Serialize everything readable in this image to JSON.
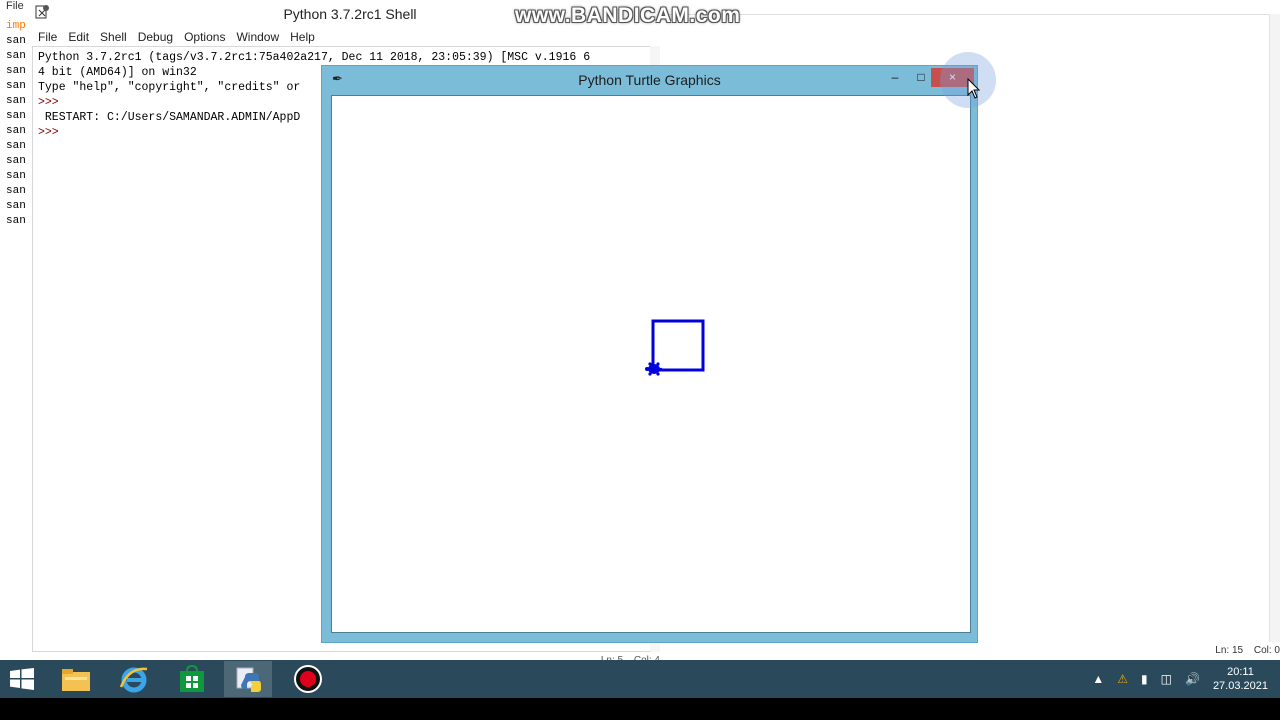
{
  "background_editor": {
    "menu_label": "File",
    "lines": [
      "imp",
      "san",
      "san",
      "san",
      "san",
      "san",
      "san",
      "san",
      "san",
      "san",
      "san",
      "san",
      "san",
      "san"
    ]
  },
  "right_editor": {
    "status_line": "Ln: 15",
    "status_col": "Col: 0"
  },
  "shell": {
    "title": "Python 3.7.2rc1 Shell",
    "menu": [
      "File",
      "Edit",
      "Shell",
      "Debug",
      "Options",
      "Window",
      "Help"
    ],
    "lines": [
      "Python 3.7.2rc1 (tags/v3.7.2rc1:75a402a217, Dec 11 2018, 23:05:39) [MSC v.1916 6",
      "4 bit (AMD64)] on win32",
      "Type \"help\", \"copyright\", \"credits\" or",
      ">>>",
      " RESTART: C:/Users/SAMANDAR.ADMIN/AppD",
      ">>>"
    ],
    "status_line": "Ln: 5",
    "status_col": "Col: 4"
  },
  "watermark": "www.BANDICAM.com",
  "turtle_window": {
    "title": "Python Turtle Graphics",
    "minimize_glyph": "–",
    "maximize_glyph": "□",
    "close_glyph": "×",
    "pen_color": "#0000dd"
  },
  "taskbar": {
    "time": "20:11",
    "date": "27.03.2021",
    "apps": [
      "windows-start",
      "file-explorer",
      "internet-explorer",
      "store",
      "python-idle",
      "bandicam-record"
    ]
  }
}
